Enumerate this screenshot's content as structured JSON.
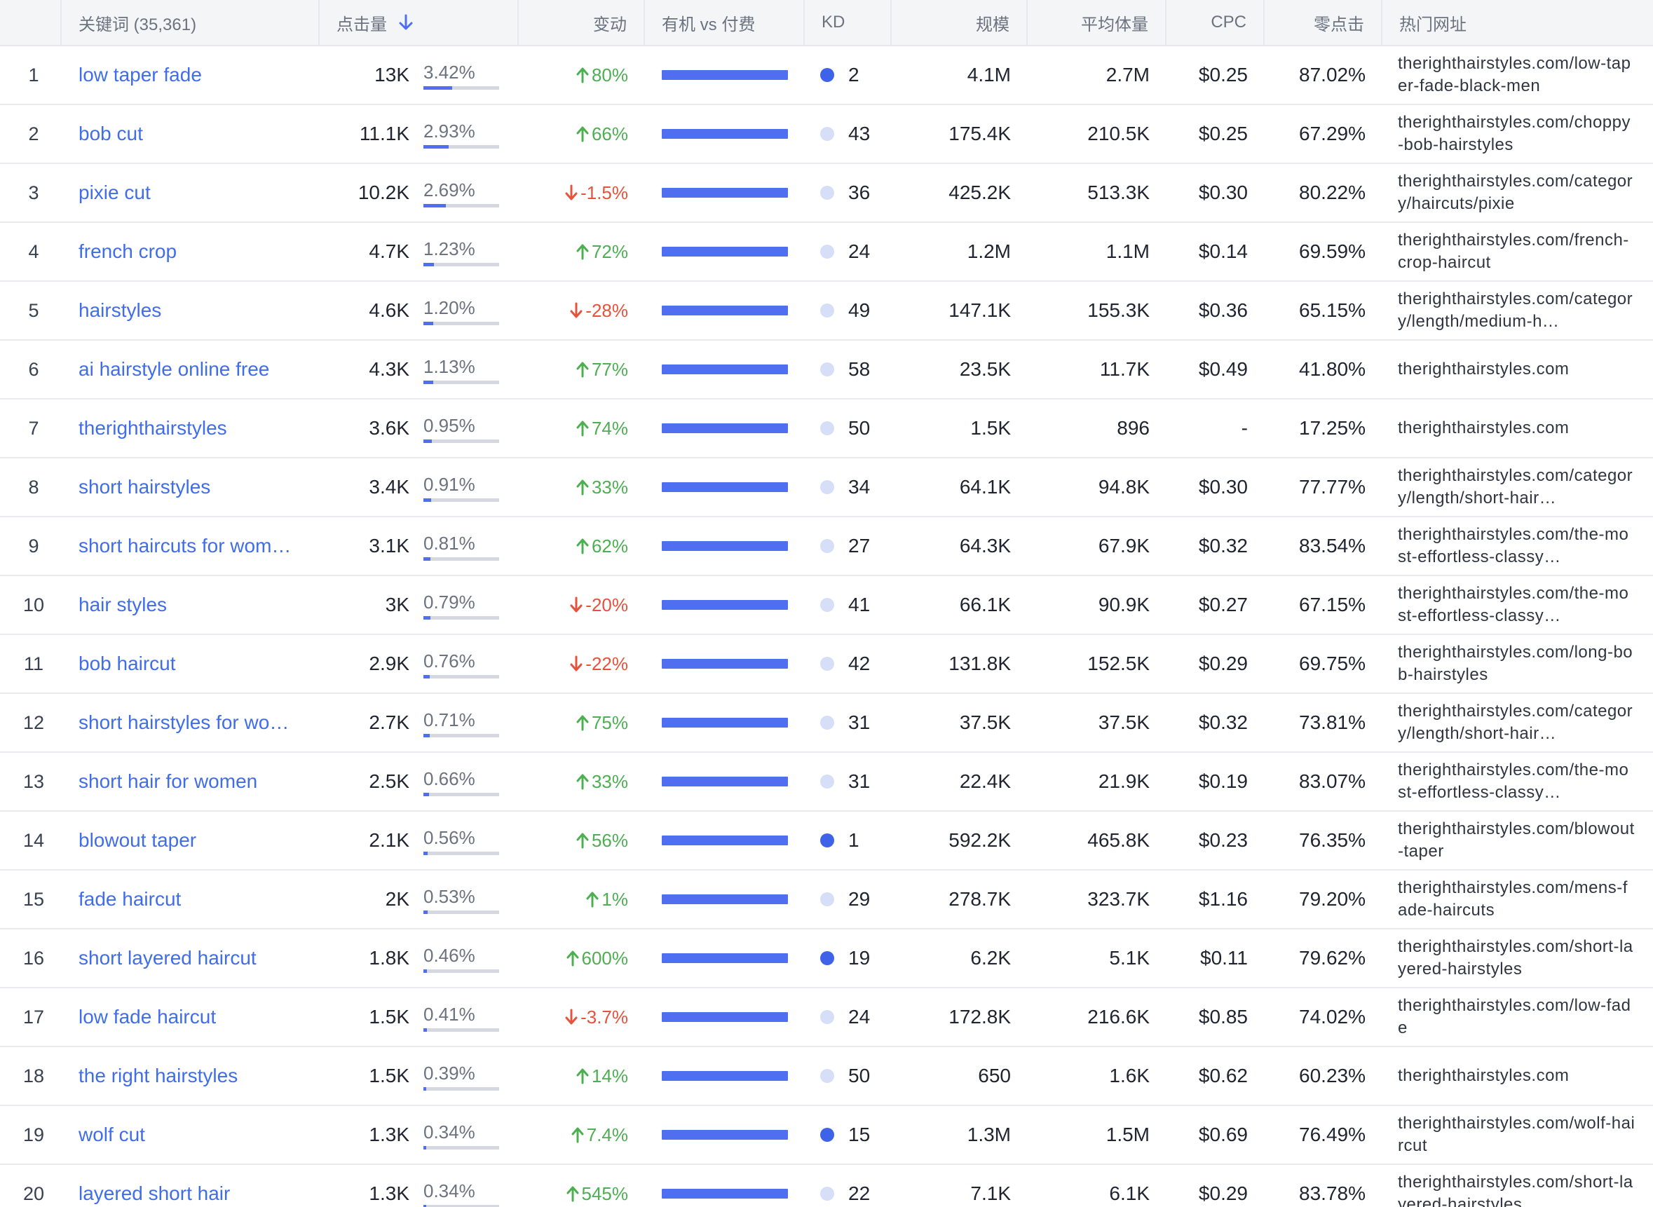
{
  "table": {
    "headers": {
      "keyword": "关键词 (35,361)",
      "clicks": "点击量",
      "change": "变动",
      "organic_vs_paid": "有机 vs 付费",
      "kd": "KD",
      "volume": "规模",
      "avg_volume": "平均体量",
      "cpc": "CPC",
      "zero_click": "零点击",
      "top_url": "热门网址"
    },
    "rows": [
      {
        "index": "1",
        "keyword": "low taper fade",
        "clicks": "13K",
        "share": "3.42%",
        "share_value": 3.42,
        "change": "80%",
        "dir": "up",
        "kd": "2",
        "kd_level": "strong",
        "volume": "4.1M",
        "avg_volume": "2.7M",
        "cpc": "$0.25",
        "zero_click": "87.02%",
        "url": "therighthairstyles.com/low-taper-fade-black-men"
      },
      {
        "index": "2",
        "keyword": "bob cut",
        "clicks": "11.1K",
        "share": "2.93%",
        "share_value": 2.93,
        "change": "66%",
        "dir": "up",
        "kd": "43",
        "kd_level": "light",
        "volume": "175.4K",
        "avg_volume": "210.5K",
        "cpc": "$0.25",
        "zero_click": "67.29%",
        "url": "therighthairstyles.com/choppy-bob-hairstyles"
      },
      {
        "index": "3",
        "keyword": "pixie cut",
        "clicks": "10.2K",
        "share": "2.69%",
        "share_value": 2.69,
        "change": "-1.5%",
        "dir": "down",
        "kd": "36",
        "kd_level": "light",
        "volume": "425.2K",
        "avg_volume": "513.3K",
        "cpc": "$0.30",
        "zero_click": "80.22%",
        "url": "therighthairstyles.com/category/haircuts/pixie"
      },
      {
        "index": "4",
        "keyword": "french crop",
        "clicks": "4.7K",
        "share": "1.23%",
        "share_value": 1.23,
        "change": "72%",
        "dir": "up",
        "kd": "24",
        "kd_level": "light",
        "volume": "1.2M",
        "avg_volume": "1.1M",
        "cpc": "$0.14",
        "zero_click": "69.59%",
        "url": "therighthairstyles.com/french-crop-haircut"
      },
      {
        "index": "5",
        "keyword": "hairstyles",
        "clicks": "4.6K",
        "share": "1.20%",
        "share_value": 1.2,
        "change": "-28%",
        "dir": "down",
        "kd": "49",
        "kd_level": "light",
        "volume": "147.1K",
        "avg_volume": "155.3K",
        "cpc": "$0.36",
        "zero_click": "65.15%",
        "url": "therighthairstyles.com/category/length/medium-h…"
      },
      {
        "index": "6",
        "keyword": "ai hairstyle online free",
        "clicks": "4.3K",
        "share": "1.13%",
        "share_value": 1.13,
        "change": "77%",
        "dir": "up",
        "kd": "58",
        "kd_level": "light",
        "volume": "23.5K",
        "avg_volume": "11.7K",
        "cpc": "$0.49",
        "zero_click": "41.80%",
        "url": "therighthairstyles.com"
      },
      {
        "index": "7",
        "keyword": "therighthairstyles",
        "clicks": "3.6K",
        "share": "0.95%",
        "share_value": 0.95,
        "change": "74%",
        "dir": "up",
        "kd": "50",
        "kd_level": "light",
        "volume": "1.5K",
        "avg_volume": "896",
        "cpc": "-",
        "zero_click": "17.25%",
        "url": "therighthairstyles.com"
      },
      {
        "index": "8",
        "keyword": "short hairstyles",
        "clicks": "3.4K",
        "share": "0.91%",
        "share_value": 0.91,
        "change": "33%",
        "dir": "up",
        "kd": "34",
        "kd_level": "light",
        "volume": "64.1K",
        "avg_volume": "94.8K",
        "cpc": "$0.30",
        "zero_click": "77.77%",
        "url": "therighthairstyles.com/category/length/short-hair…"
      },
      {
        "index": "9",
        "keyword": "short haircuts for wom…",
        "clicks": "3.1K",
        "share": "0.81%",
        "share_value": 0.81,
        "change": "62%",
        "dir": "up",
        "kd": "27",
        "kd_level": "light",
        "volume": "64.3K",
        "avg_volume": "67.9K",
        "cpc": "$0.32",
        "zero_click": "83.54%",
        "url": "therighthairstyles.com/the-most-effortless-classy…"
      },
      {
        "index": "10",
        "keyword": "hair styles",
        "clicks": "3K",
        "share": "0.79%",
        "share_value": 0.79,
        "change": "-20%",
        "dir": "down",
        "kd": "41",
        "kd_level": "light",
        "volume": "66.1K",
        "avg_volume": "90.9K",
        "cpc": "$0.27",
        "zero_click": "67.15%",
        "url": "therighthairstyles.com/the-most-effortless-classy…"
      },
      {
        "index": "11",
        "keyword": "bob haircut",
        "clicks": "2.9K",
        "share": "0.76%",
        "share_value": 0.76,
        "change": "-22%",
        "dir": "down",
        "kd": "42",
        "kd_level": "light",
        "volume": "131.8K",
        "avg_volume": "152.5K",
        "cpc": "$0.29",
        "zero_click": "69.75%",
        "url": "therighthairstyles.com/long-bob-hairstyles"
      },
      {
        "index": "12",
        "keyword": "short hairstyles for wo…",
        "clicks": "2.7K",
        "share": "0.71%",
        "share_value": 0.71,
        "change": "75%",
        "dir": "up",
        "kd": "31",
        "kd_level": "light",
        "volume": "37.5K",
        "avg_volume": "37.5K",
        "cpc": "$0.32",
        "zero_click": "73.81%",
        "url": "therighthairstyles.com/category/length/short-hair…"
      },
      {
        "index": "13",
        "keyword": "short hair for women",
        "clicks": "2.5K",
        "share": "0.66%",
        "share_value": 0.66,
        "change": "33%",
        "dir": "up",
        "kd": "31",
        "kd_level": "light",
        "volume": "22.4K",
        "avg_volume": "21.9K",
        "cpc": "$0.19",
        "zero_click": "83.07%",
        "url": "therighthairstyles.com/the-most-effortless-classy…"
      },
      {
        "index": "14",
        "keyword": "blowout taper",
        "clicks": "2.1K",
        "share": "0.56%",
        "share_value": 0.56,
        "change": "56%",
        "dir": "up",
        "kd": "1",
        "kd_level": "strong",
        "volume": "592.2K",
        "avg_volume": "465.8K",
        "cpc": "$0.23",
        "zero_click": "76.35%",
        "url": "therighthairstyles.com/blowout-taper"
      },
      {
        "index": "15",
        "keyword": "fade haircut",
        "clicks": "2K",
        "share": "0.53%",
        "share_value": 0.53,
        "change": "1%",
        "dir": "up",
        "kd": "29",
        "kd_level": "light",
        "volume": "278.7K",
        "avg_volume": "323.7K",
        "cpc": "$1.16",
        "zero_click": "79.20%",
        "url": "therighthairstyles.com/mens-fade-haircuts"
      },
      {
        "index": "16",
        "keyword": "short layered haircut",
        "clicks": "1.8K",
        "share": "0.46%",
        "share_value": 0.46,
        "change": "600%",
        "dir": "up",
        "kd": "19",
        "kd_level": "strong",
        "volume": "6.2K",
        "avg_volume": "5.1K",
        "cpc": "$0.11",
        "zero_click": "79.62%",
        "url": "therighthairstyles.com/short-layered-hairstyles"
      },
      {
        "index": "17",
        "keyword": "low fade haircut",
        "clicks": "1.5K",
        "share": "0.41%",
        "share_value": 0.41,
        "change": "-3.7%",
        "dir": "down",
        "kd": "24",
        "kd_level": "light",
        "volume": "172.8K",
        "avg_volume": "216.6K",
        "cpc": "$0.85",
        "zero_click": "74.02%",
        "url": "therighthairstyles.com/low-fade"
      },
      {
        "index": "18",
        "keyword": "the right hairstyles",
        "clicks": "1.5K",
        "share": "0.39%",
        "share_value": 0.39,
        "change": "14%",
        "dir": "up",
        "kd": "50",
        "kd_level": "light",
        "volume": "650",
        "avg_volume": "1.6K",
        "cpc": "$0.62",
        "zero_click": "60.23%",
        "url": "therighthairstyles.com"
      },
      {
        "index": "19",
        "keyword": "wolf cut",
        "clicks": "1.3K",
        "share": "0.34%",
        "share_value": 0.34,
        "change": "7.4%",
        "dir": "up",
        "kd": "15",
        "kd_level": "strong",
        "volume": "1.3M",
        "avg_volume": "1.5M",
        "cpc": "$0.69",
        "zero_click": "76.49%",
        "url": "therighthairstyles.com/wolf-haircut"
      },
      {
        "index": "20",
        "keyword": "layered short hair",
        "clicks": "1.3K",
        "share": "0.34%",
        "share_value": 0.34,
        "change": "545%",
        "dir": "up",
        "kd": "22",
        "kd_level": "light",
        "volume": "7.1K",
        "avg_volume": "6.1K",
        "cpc": "$0.29",
        "zero_click": "83.78%",
        "url": "therighthairstyles.com/short-layered-hairstyles"
      }
    ]
  },
  "colors": {
    "accent": "#4f6ef0",
    "link": "#3f6ee8",
    "up": "#4caf50",
    "down": "#e5533c",
    "kd_strong": "#3f63e8",
    "kd_light": "#d6dff7"
  },
  "icons": {
    "sort": "arrow-down-icon",
    "up": "arrow-up-icon",
    "down": "arrow-down-icon"
  }
}
